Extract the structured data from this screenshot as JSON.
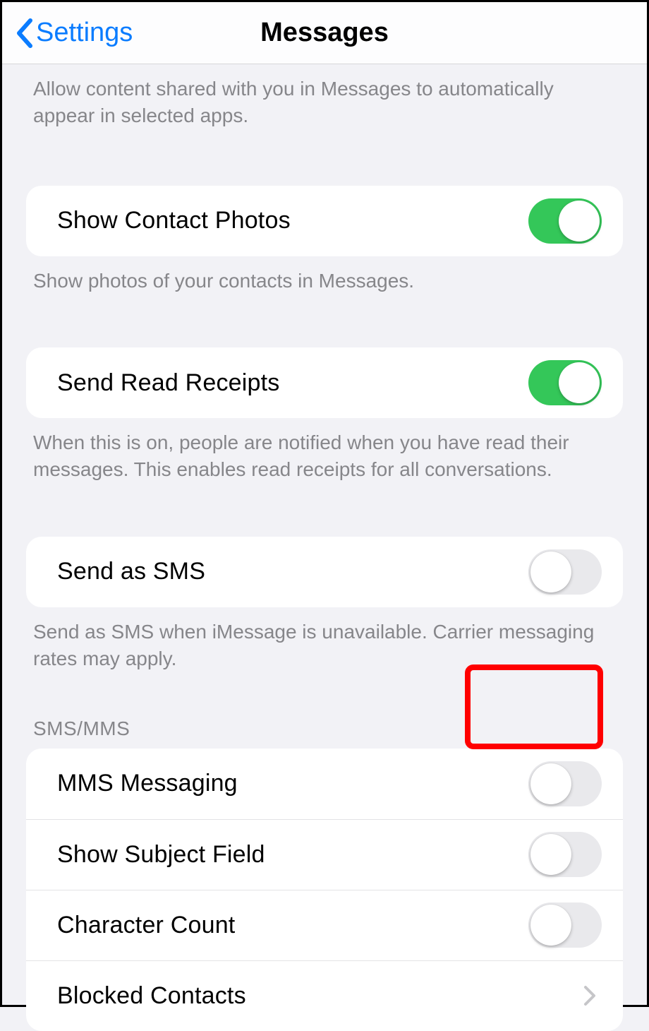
{
  "header": {
    "back_label": "Settings",
    "title": "Messages"
  },
  "sharedWithYou": {
    "footer": "Allow content shared with you in Messages to automatically appear in selected apps."
  },
  "contactPhotos": {
    "label": "Show Contact Photos",
    "on": true,
    "footer": "Show photos of your contacts in Messages."
  },
  "readReceipts": {
    "label": "Send Read Receipts",
    "on": true,
    "footer": "When this is on, people are notified when you have read their messages. This enables read receipts for all conversations."
  },
  "sendAsSms": {
    "label": "Send as SMS",
    "on": false,
    "footer": "Send as SMS when iMessage is unavailable. Carrier messaging rates may apply."
  },
  "smsMms": {
    "header": "SMS/MMS",
    "mms": {
      "label": "MMS Messaging",
      "on": false
    },
    "subject": {
      "label": "Show Subject Field",
      "on": false
    },
    "charCount": {
      "label": "Character Count",
      "on": false
    },
    "blocked": {
      "label": "Blocked Contacts"
    }
  }
}
